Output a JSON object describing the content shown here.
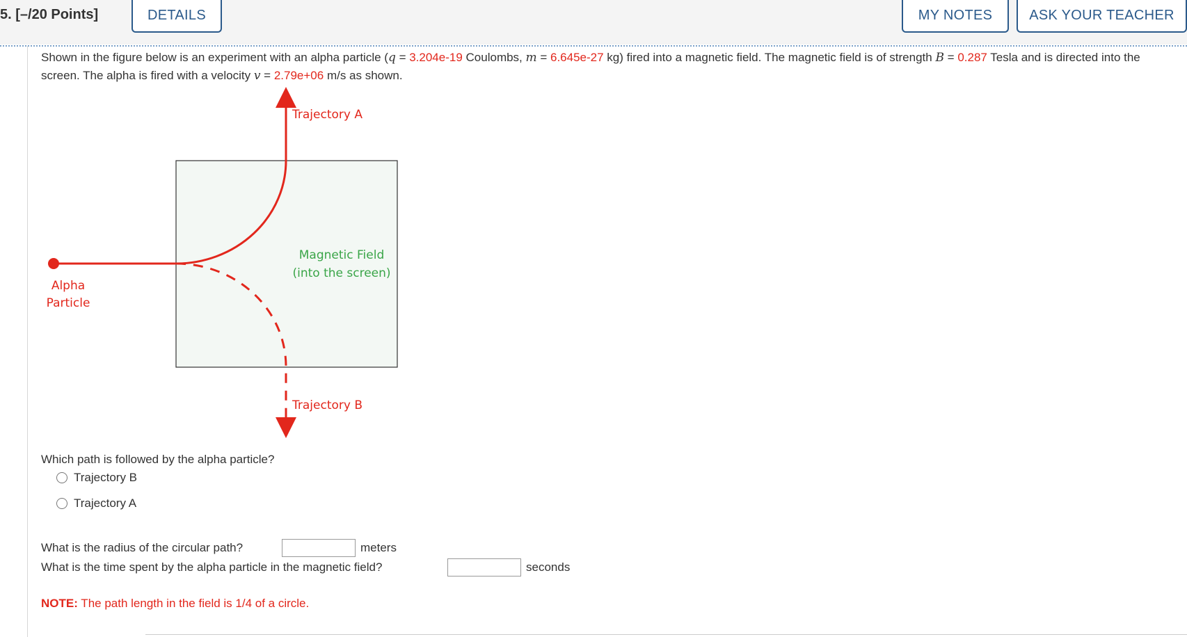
{
  "header": {
    "question_number": "5.  [–/20 Points]",
    "details_label": "DETAILS",
    "my_notes_label": "MY NOTES",
    "ask_teacher_label": "ASK YOUR TEACHER"
  },
  "prompt": {
    "part1": "Shown in the figure below is an experiment with an alpha particle (",
    "q_var": "q",
    "eq1": " = ",
    "q_value": "3.204e-19",
    "part2": " Coulombs, ",
    "m_var": "m",
    "eq2": " = ",
    "m_value": "6.645e-27",
    "part3": " kg) fired into a magnetic field. The magnetic field is of strength ",
    "b_var": "B",
    "eq3": " = ",
    "b_value": "0.287",
    "part4": " Tesla and is directed into the screen. The alpha is fired with a velocity ",
    "v_var": "v",
    "eq4": " = ",
    "v_value": "2.79e+06",
    "part5": " m/s as shown."
  },
  "figure": {
    "trajectory_a_label": "Trajectory A",
    "trajectory_b_label": "Trajectory B",
    "field_label_line1": "Magnetic Field",
    "field_label_line2": "(into the screen)",
    "particle_label_line1": "Alpha",
    "particle_label_line2": "Particle",
    "colors": {
      "red": "#e2271c",
      "green": "#3aa548",
      "field_fill": "#f3f8f4"
    }
  },
  "question1": {
    "text": "Which path is followed by the alpha particle?",
    "options": [
      "Trajectory B",
      "Trajectory A"
    ]
  },
  "question2": {
    "text": "What is the radius of the circular path?",
    "unit": "meters",
    "value": ""
  },
  "question3": {
    "text": "What is the time spent by the alpha particle in the magnetic field?",
    "unit": "seconds",
    "value": ""
  },
  "note": {
    "label": "NOTE:",
    "text": " The path length in the field is 1/4 of a circle."
  }
}
